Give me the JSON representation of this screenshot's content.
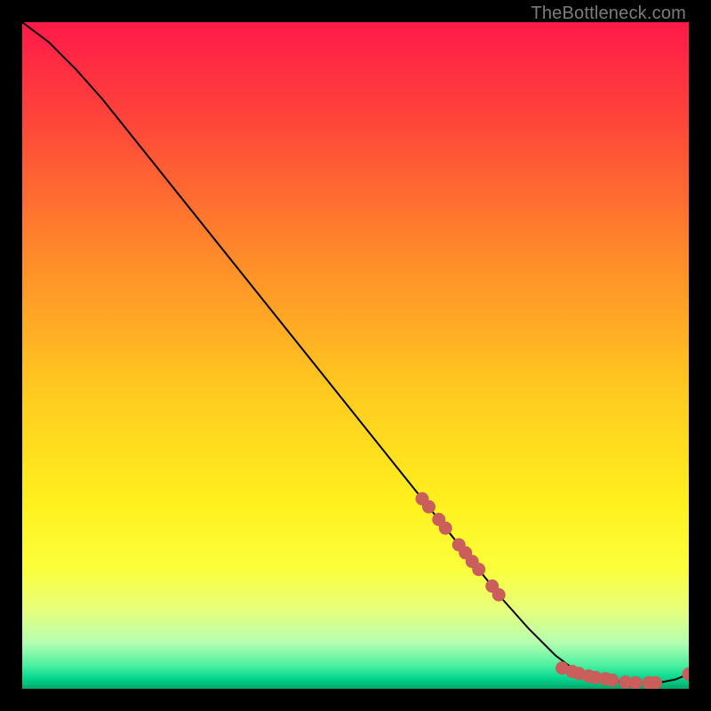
{
  "attribution": "TheBottleneck.com",
  "colors": {
    "background": "#000000",
    "marker": "#c95e5a",
    "line": "#000000",
    "gradient_stops": [
      {
        "offset": 0.0,
        "color": "#ff1a49"
      },
      {
        "offset": 0.15,
        "color": "#ff4639"
      },
      {
        "offset": 0.35,
        "color": "#ff8a2a"
      },
      {
        "offset": 0.55,
        "color": "#ffc91f"
      },
      {
        "offset": 0.72,
        "color": "#fff01e"
      },
      {
        "offset": 0.82,
        "color": "#fbff3a"
      },
      {
        "offset": 0.88,
        "color": "#e8ff7a"
      },
      {
        "offset": 0.93,
        "color": "#b6ffb0"
      },
      {
        "offset": 0.965,
        "color": "#4cf0a0"
      },
      {
        "offset": 0.985,
        "color": "#00d68f"
      },
      {
        "offset": 1.0,
        "color": "#00a565"
      }
    ]
  },
  "chart_data": {
    "type": "line",
    "title": "",
    "xlabel": "",
    "ylabel": "",
    "xlim": [
      0,
      100
    ],
    "ylim": [
      0,
      100
    ],
    "grid": false,
    "legend": false,
    "series": [
      {
        "name": "curve",
        "style": "line",
        "x": [
          0,
          4,
          8,
          12,
          16,
          20,
          24,
          28,
          32,
          36,
          40,
          44,
          48,
          52,
          56,
          60,
          64,
          68,
          72,
          76,
          80,
          82,
          84,
          86,
          88,
          90,
          92,
          94,
          96,
          98,
          100
        ],
        "y": [
          100,
          97,
          93,
          88.5,
          83.5,
          78.5,
          73.5,
          68.5,
          63.5,
          58.5,
          53.5,
          48.5,
          43.5,
          38.5,
          33.5,
          28.5,
          23.5,
          18.5,
          13.5,
          9,
          5,
          3.5,
          2.5,
          1.8,
          1.3,
          1.0,
          0.9,
          0.9,
          1.0,
          1.4,
          2.2
        ]
      },
      {
        "name": "markers",
        "style": "scatter",
        "x": [
          60,
          61,
          62.5,
          63.5,
          65.5,
          66.5,
          67.5,
          68.5,
          70.5,
          71.5,
          81,
          82.5,
          83.5,
          85,
          86,
          87.5,
          88.5,
          90.5,
          92,
          94,
          95,
          100
        ],
        "y": [
          28.5,
          27.3,
          25.4,
          24.1,
          21.6,
          20.4,
          19.1,
          17.9,
          15.4,
          14.1,
          3.1,
          2.6,
          2.3,
          1.9,
          1.7,
          1.5,
          1.3,
          1.0,
          0.9,
          0.9,
          0.9,
          2.2
        ]
      }
    ]
  }
}
